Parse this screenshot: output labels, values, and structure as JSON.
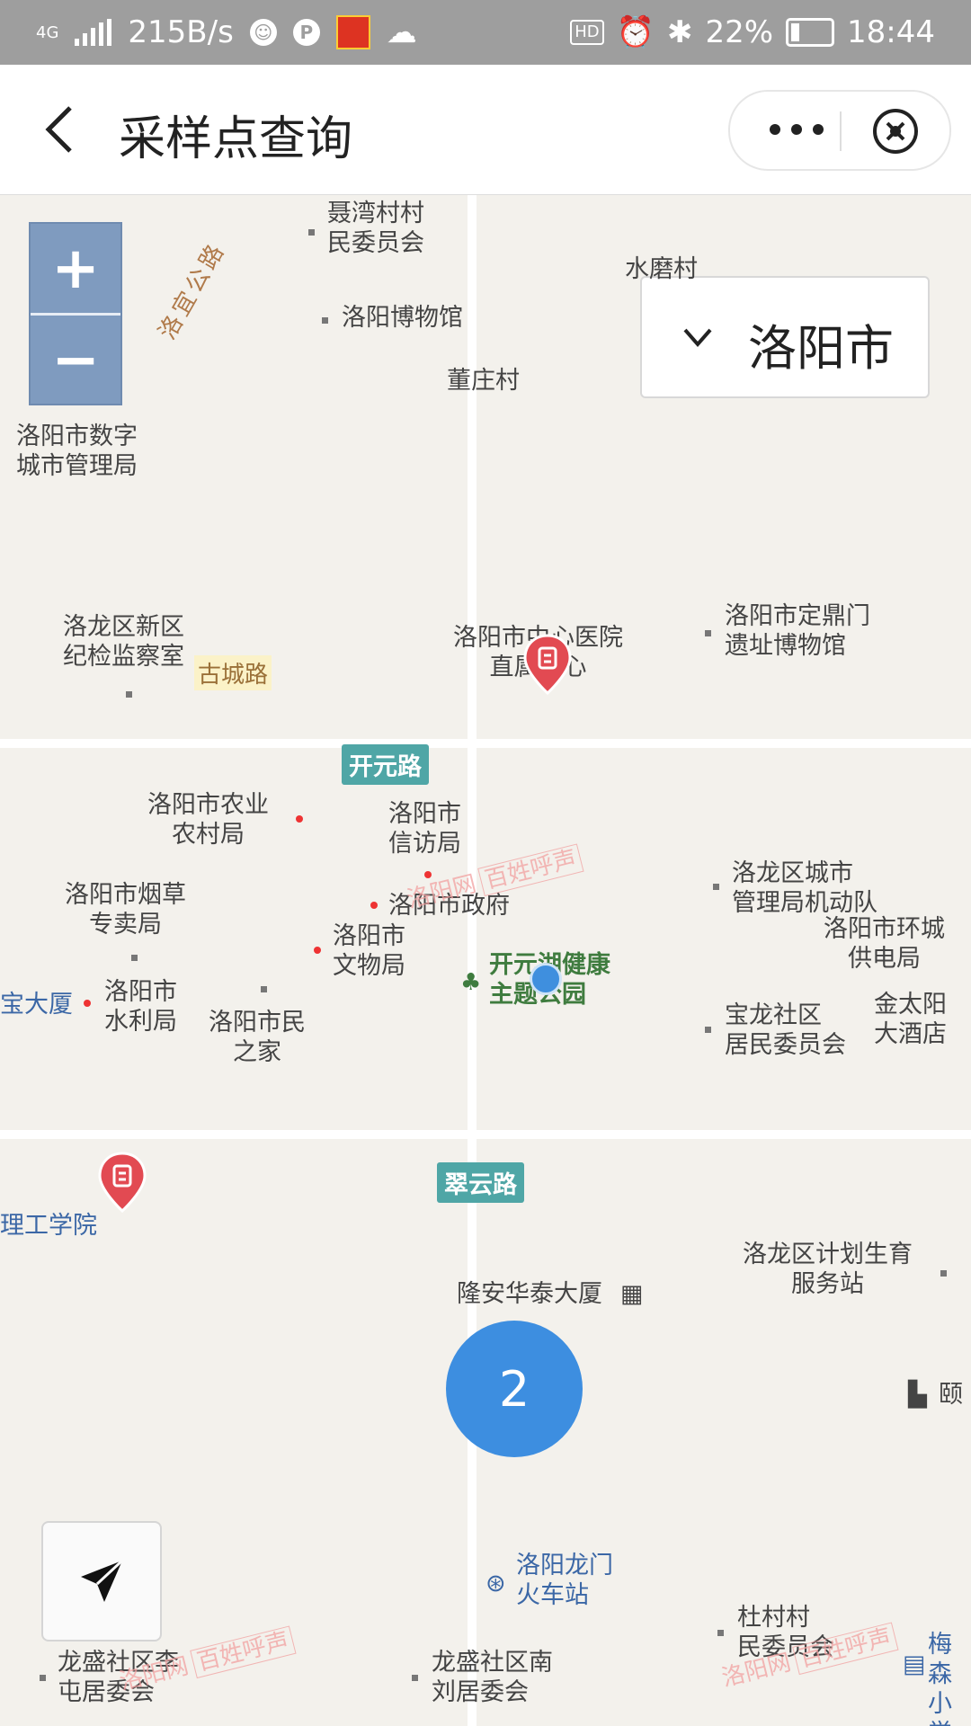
{
  "status_bar": {
    "network": "4G",
    "speed": "215B/s",
    "hd": "HD",
    "battery": "22%",
    "time": "18:44"
  },
  "nav": {
    "title": "采样点查询"
  },
  "map": {
    "zoom_in": "+",
    "zoom_out": "−",
    "city": "洛阳市",
    "cluster_count": "2",
    "roads": {
      "kaiyuan": "开元路",
      "cuiyun": "翠云路",
      "gucheng": "古城路",
      "luoyi": "洛宜公路"
    },
    "pois": {
      "p1": "聂湾村村\n民委员会",
      "p2": "水磨村",
      "p3": "洛阳博物馆",
      "p4": "董庄村",
      "p5": "洛阳市数字\n城市管理局",
      "p6": "洛龙区新区\n纪检监察室",
      "p7": "洛阳市中心医院\n直属中心",
      "p8": "洛阳市定鼎门\n遗址博物馆",
      "p9": "洛阳市农业\n农村局",
      "p10": "洛阳市\n信访局",
      "p11": "洛阳市烟草\n专卖局",
      "p12": "洛阳市政府",
      "p13": "洛龙区城市\n管理局机动队",
      "p14": "洛阳市环城\n供电局",
      "p15": "洛阳市\n文物局",
      "p16": "开元湖健康\n主题公园",
      "p17": "宝大厦",
      "p18": "洛阳市\n水利局",
      "p19": "洛阳市民\n之家",
      "p20": "宝龙社区\n居民委员会",
      "p21": "金太阳\n大酒店",
      "p22": "理工学院",
      "p23": "洛龙区计划生育\n服务站",
      "p24": "隆安华泰大厦",
      "p25": "颐",
      "p26": "洛阳龙门\n火车站",
      "p27": "杜村村\n民委员会",
      "p28": "梅森\n小学",
      "p29": "龙盛社区李\n屯居委会",
      "p30": "龙盛社区南\n刘居委会"
    },
    "watermark": {
      "site": "洛阳网",
      "brand": "百姓呼声"
    }
  },
  "colors": {
    "status_bar": "#9e9e9e",
    "marker": "#e24a52",
    "cluster": "#3d8ee0",
    "zoom": "#7f9bbf",
    "road_tag": "#4fa6a6"
  }
}
